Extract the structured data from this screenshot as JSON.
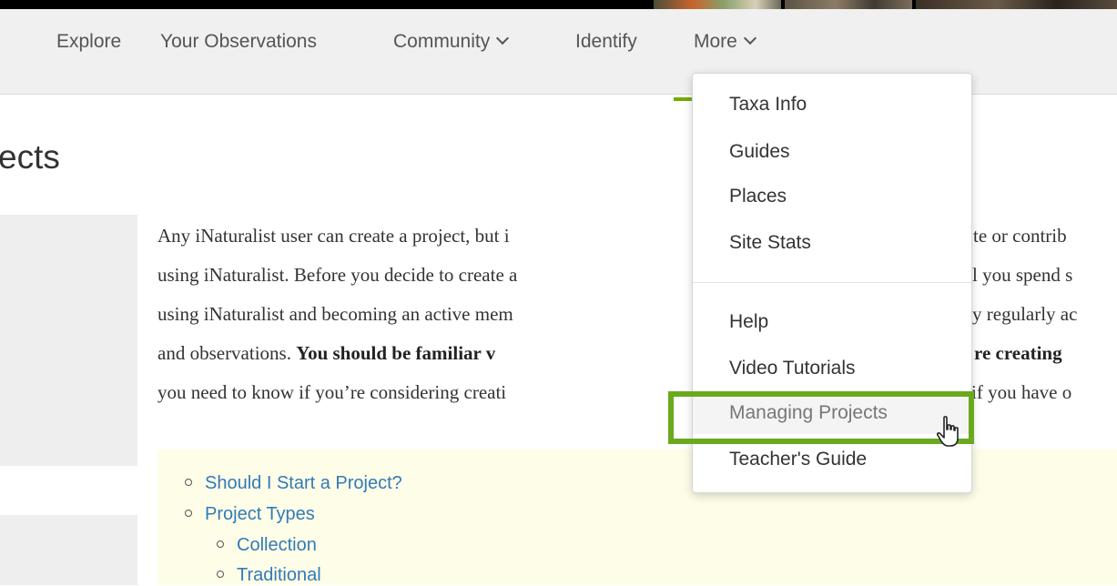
{
  "nav": {
    "items": [
      {
        "label": "Explore"
      },
      {
        "label": "Your Observations"
      },
      {
        "label": "Community"
      },
      {
        "label": "Identify"
      },
      {
        "label": "More"
      }
    ]
  },
  "page": {
    "title_fragment": "ects"
  },
  "body": {
    "lines": [
      {
        "pre": "Any iNaturalist user can create a project, but i",
        "post": "te or contrib"
      },
      {
        "pre": "using iNaturalist. Before you decide to create a",
        "post": "l you spend s"
      },
      {
        "pre": "using iNaturalist and becoming an active mem",
        "post": "y regularly ac"
      },
      {
        "pre": "and observations. ",
        "bold_pre": "You should be familiar v",
        "bold_post": "re creating"
      },
      {
        "pre": "you need to know if you’re considering creati",
        "post": "if you have o"
      }
    ]
  },
  "toc": {
    "items": [
      {
        "label": "Should I Start a Project?"
      },
      {
        "label": "Project Types"
      },
      {
        "label": "Collection"
      },
      {
        "label": "Traditional"
      }
    ]
  },
  "dropdown": {
    "items": [
      {
        "label": "Taxa Info"
      },
      {
        "label": "Guides"
      },
      {
        "label": "Places"
      },
      {
        "label": "Site Stats"
      },
      {
        "label": "Help"
      },
      {
        "label": "Video Tutorials"
      },
      {
        "label": "Managing Projects"
      },
      {
        "label": "Teacher's Guide"
      }
    ]
  },
  "colors": {
    "accent": "#74ac00",
    "highlight": "#6aa91e",
    "link": "#337ab7"
  }
}
